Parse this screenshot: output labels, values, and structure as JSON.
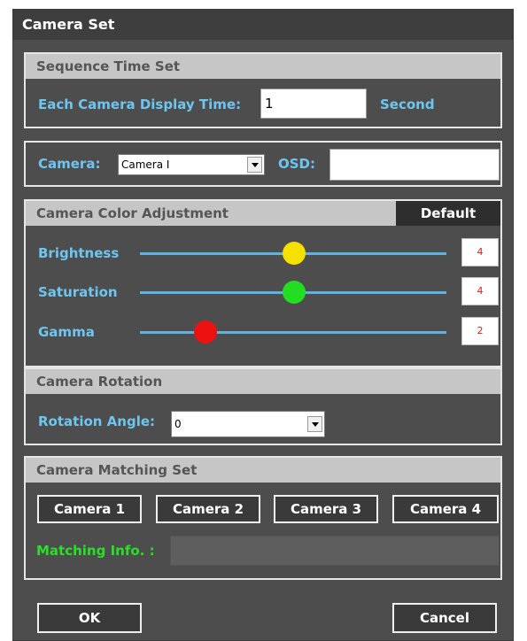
{
  "window": {
    "title": "Camera Set"
  },
  "sequence": {
    "header": "Sequence Time Set",
    "display_time_label": "Each Camera Display Time:",
    "display_time_value": "1",
    "unit": "Second"
  },
  "camera_select": {
    "camera_label": "Camera:",
    "camera_value": "Camera I",
    "osd_label": "OSD:",
    "osd_value": ""
  },
  "color_adjust": {
    "header": "Camera Color Adjustment",
    "default_label": "Default",
    "sliders": [
      {
        "label": "Brightness",
        "value": "4",
        "color": "#f5e000"
      },
      {
        "label": "Saturation",
        "value": "4",
        "color": "#22dd22"
      },
      {
        "label": "Gamma",
        "value": "2",
        "color": "#ee1111"
      }
    ]
  },
  "rotation": {
    "header": "Camera Rotation",
    "angle_label": "Rotation Angle:",
    "angle_value": "0"
  },
  "matching": {
    "header": "Camera Matching Set",
    "buttons": [
      "Camera 1",
      "Camera 2",
      "Camera 3",
      "Camera 4"
    ],
    "info_label": "Matching Info. :",
    "info_value": ""
  },
  "footer": {
    "ok_label": "OK",
    "cancel_label": "Cancel"
  }
}
